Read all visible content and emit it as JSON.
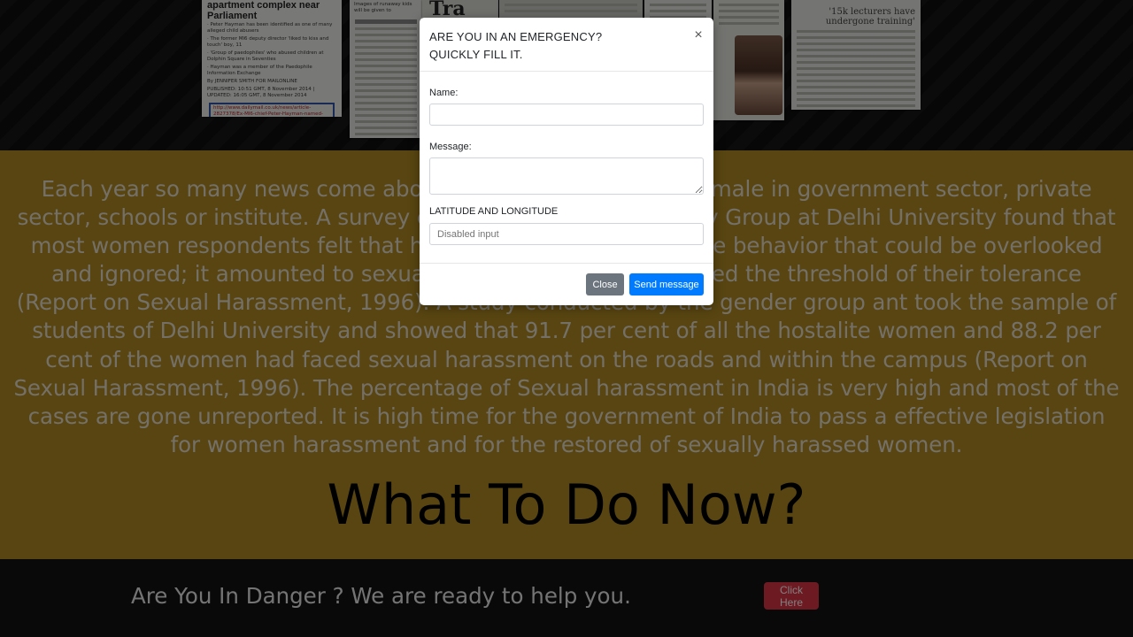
{
  "clipping1": {
    "headline": "apartment complex near Parliament",
    "bullets": [
      "· Peter Hayman has been identified as one of many alleged child abusers",
      "· The former MI6 deputy director 'liked to kiss and touch' boy, 11",
      "· 'Group of paedophiles' who abused children at Dolphin Square in Seventies",
      "· Hayman was a member of the Paedophile Information Exchange"
    ],
    "byline": "By JENNIFER SMITH FOR MAILONLINE",
    "published": "PUBLISHED: 10:51 GMT, 8 November 2014 | UPDATED: 16:05 GMT, 8 November 2014",
    "link": "http://www.dailymail.co.uk/news/article-2827378/Ex-MI6-chief-Peter-Hayman-named-VIP-sexually-abused-boys-Dolphin-Square-apartment-complex-near-Parliament.html"
  },
  "clipping2": {
    "caption": "Images of runaway kids will be given to"
  },
  "clipping3": {
    "headline": "Tra"
  },
  "clipping7": {
    "headline": "'15k lecturers have undergone training'"
  },
  "story": {
    "paragraph": "Each year so many news come about sexual harassment of female in government sector, private sector, schools or institute. A survey conducted by Gender Study Group at Delhi University found that most women respondents felt that harassment was not a simple behavior that could be overlooked and ignored; it amounted to sexual harassment since it crossed the threshold of their tolerance (Report on Sexual Harassment, 1996). A study conducted by the gender group ant took the sample of students of Delhi University and showed that 91.7 per cent of all the hostalite women and 88.2 per cent of the women had faced sexual harassment on the roads and within the campus (Report on Sexual Harassment, 1996). The percentage of Sexual harassment in India is very high and most of the cases are gone unreported. It is high time for the government of India to pass a effective legislation for women harassment and for the restored of sexually harassed women."
  },
  "section": {
    "title": "What To Do Now?"
  },
  "cta": {
    "text": "Are You In Danger ? We are ready to help you.",
    "button": "Click Here"
  },
  "modal": {
    "title_line1": "ARE YOU IN AN EMERGENCY?",
    "title_line2": "QUICKLY FILL IT.",
    "close_glyph": "×",
    "name_label": "Name:",
    "name_value": "",
    "message_label": "Message:",
    "message_value": "",
    "latlng_label": "LATITUDE AND LONGITUDE",
    "latlng_placeholder": "Disabled input",
    "close_button": "Close",
    "send_button": "Send message"
  },
  "colors": {
    "band_gold": "#b08a22",
    "send_blue": "#007bff",
    "close_gray": "#6c757d",
    "danger_red": "#dc3545"
  }
}
